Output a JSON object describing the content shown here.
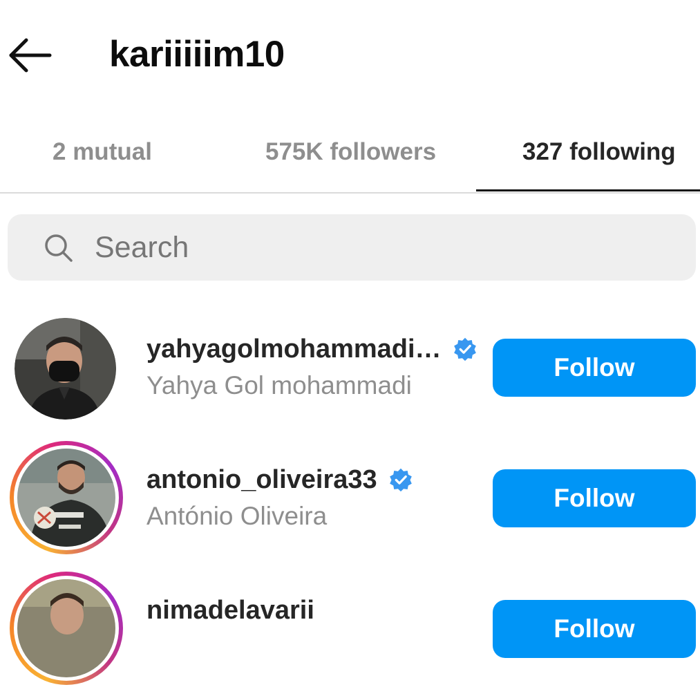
{
  "header": {
    "title": "kariiiiim10",
    "back_icon": "arrow-left-icon"
  },
  "tabs": [
    {
      "label": "2 mutual",
      "active": false
    },
    {
      "label": "575K followers",
      "active": false
    },
    {
      "label": "327 following",
      "active": true
    }
  ],
  "search": {
    "placeholder": "Search",
    "value": "",
    "icon": "search-icon"
  },
  "accounts": [
    {
      "username": "yahyagolmohammadi…",
      "full_name": "Yahya Gol mohammadi",
      "verified": true,
      "story_ring": false,
      "button_label": "Follow"
    },
    {
      "username": "antonio_oliveira33",
      "full_name": "António Oliveira",
      "verified": true,
      "story_ring": true,
      "button_label": "Follow"
    },
    {
      "username": "nimadelavarii",
      "full_name": "",
      "verified": false,
      "story_ring": true,
      "button_label": "Follow"
    }
  ],
  "colors": {
    "accent_blue": "#0095f6",
    "verified_blue": "#3897f0",
    "secondary_text": "#8e8e8e",
    "primary_text": "#262626",
    "search_bg": "#efefef"
  }
}
